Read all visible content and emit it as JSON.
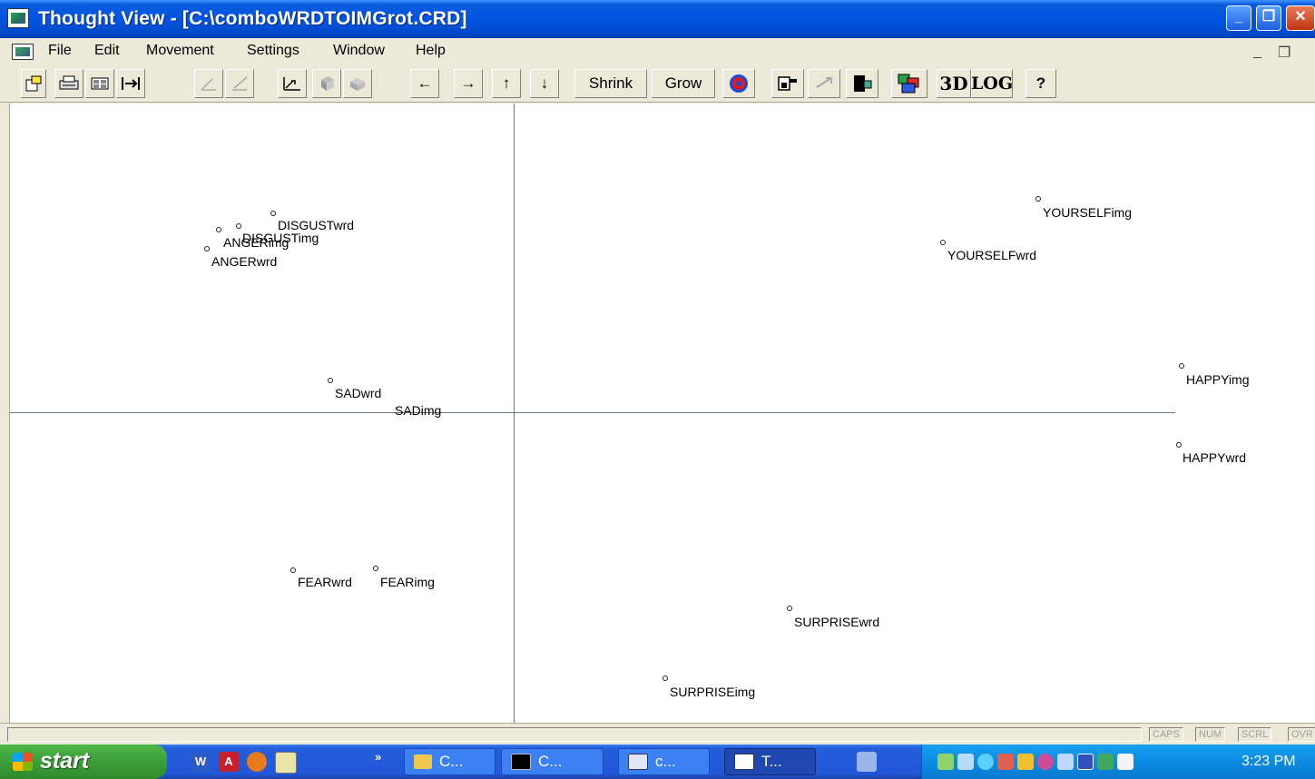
{
  "window": {
    "title": "Thought View - [C:\\comboWRDTOIMGrot.CRD]",
    "controls": {
      "minimize": "_",
      "restore": "❐",
      "close": "✕"
    }
  },
  "menu": {
    "items": [
      "File",
      "Edit",
      "Movement",
      "Settings",
      "Window",
      "Help"
    ],
    "mdi_minimize": "_",
    "mdi_restore": "❐"
  },
  "toolbar": {
    "icon_buttons": [
      "open-icon",
      "print-icon",
      "grid-icon",
      "fit-width-icon",
      "curve-up-icon",
      "curve-left-icon",
      "plot-arrow-icon",
      "cube-left-icon",
      "cube-right-icon",
      "cube-select-icon",
      "cube-arrow-icon",
      "white-box-icon",
      "color-boxes-icon",
      "help-icon"
    ],
    "arrows": {
      "left": "←",
      "right": "→",
      "up": "↑",
      "down": "↓"
    },
    "shrink_label": "Shrink",
    "grow_label": "Grow",
    "label_3d": "3D",
    "label_log": "LOG",
    "help_label": "?"
  },
  "plot": {
    "points": [
      {
        "label": "DISGUSTwrd"
      },
      {
        "label": "DISGUSTimg"
      },
      {
        "label": "ANGERimg"
      },
      {
        "label": "ANGERwrd"
      },
      {
        "label": "SADwrd"
      },
      {
        "label": "SADimg"
      },
      {
        "label": "YOURSELFimg"
      },
      {
        "label": "YOURSELFwrd"
      },
      {
        "label": "HAPPYimg"
      },
      {
        "label": "HAPPYwrd"
      },
      {
        "label": "FEARwrd"
      },
      {
        "label": "FEARimg"
      },
      {
        "label": "SURPRISEwrd"
      },
      {
        "label": "SURPRISEimg"
      }
    ]
  },
  "status": {
    "indicators": [
      "CAPS",
      "NUM",
      "SCRL",
      "OVR"
    ]
  },
  "taskbar": {
    "start_label": "start",
    "quicklaunch": [
      "word-icon",
      "acrobat-icon",
      "firefox-icon",
      "notepad-icon"
    ],
    "more": "»",
    "tasks": [
      "C...",
      "C...",
      "c...",
      "T..."
    ],
    "clock": "3:23 PM",
    "tray_icons": [
      "network-icon",
      "wireless-icon",
      "search-icon",
      "monitor-icon",
      "paint-icon",
      "security-icon",
      "hardware-icon",
      "display-icon",
      "settings-icon",
      "flag-icon"
    ]
  },
  "colors": {
    "title_blue": "#0054e3",
    "taskbar_blue": "#245edb",
    "start_green": "#3c9e38",
    "axis": "#6d7a73",
    "chrome": "#ece9d8"
  }
}
